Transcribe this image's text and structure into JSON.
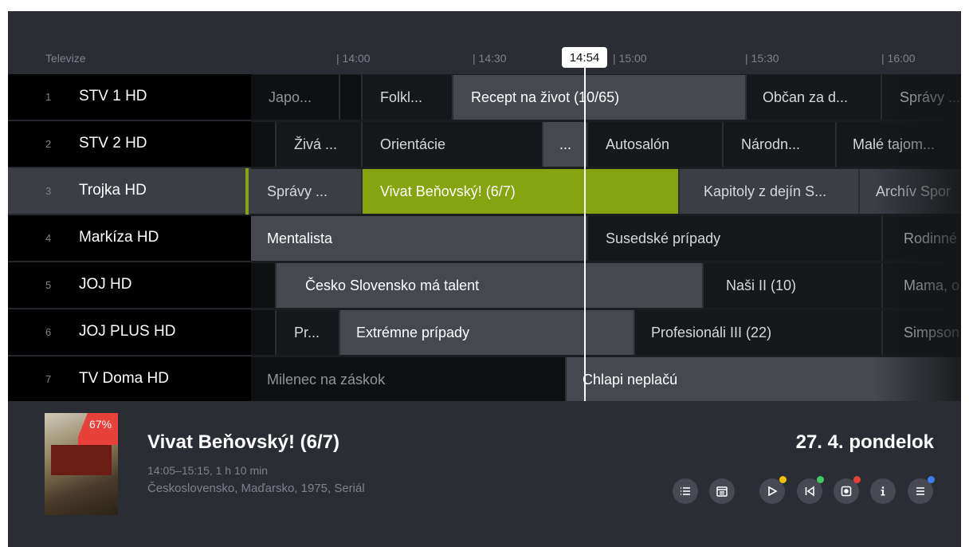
{
  "header": {
    "section_label": "Televize",
    "time_ticks": [
      "| 14:00",
      "| 14:30",
      "| 15:00",
      "| 15:30",
      "| 16:00"
    ],
    "current_time": "14:54"
  },
  "channels": [
    {
      "number": "1",
      "name": "STV 1 HD"
    },
    {
      "number": "2",
      "name": "STV 2 HD"
    },
    {
      "number": "3",
      "name": "Trojka HD"
    },
    {
      "number": "4",
      "name": "Markíza HD"
    },
    {
      "number": "5",
      "name": "JOJ HD"
    },
    {
      "number": "6",
      "name": "JOJ PLUS HD"
    },
    {
      "number": "7",
      "name": "TV Doma HD"
    }
  ],
  "schedule": [
    [
      "Japo...",
      "",
      "Folkl...",
      "Recept na život (10/65)",
      "Občan za d...",
      "Správy ..."
    ],
    [
      "Živá ...",
      "Orientácie",
      "...",
      "Autosalón",
      "Národn...",
      "Malé tajom..."
    ],
    [
      "Správy ...",
      "Vivat Beňovský! (6/7)",
      "Kapitoly z dejín S...",
      "Archív Spor"
    ],
    [
      "Mentalista",
      "Susedské prípady",
      "Rodinné"
    ],
    [
      "Česko Slovensko má talent",
      "Naši II (10)",
      "Mama, o"
    ],
    [
      "Pr...",
      "Extrémne prípady",
      "Profesionáli III (22)",
      "Simpson"
    ],
    [
      "Milenec na záskok",
      "Chlapi neplačú"
    ]
  ],
  "info": {
    "progress": "67%",
    "title": "Vivat Beňovský! (6/7)",
    "time": "14:05–15:15, 1 h 10 min",
    "meta": "Československo, Maďarsko, 1975, Seriál",
    "date": "27. 4. pondelok"
  },
  "controls": [
    {
      "icon": "list-icon"
    },
    {
      "icon": "calendar-icon"
    },
    {
      "icon": "play-icon",
      "dot": "#f2c200"
    },
    {
      "icon": "restart-icon",
      "dot": "#44c767"
    },
    {
      "icon": "record-icon",
      "dot": "#e8403a"
    },
    {
      "icon": "info-icon"
    },
    {
      "icon": "menu-icon",
      "dot": "#3f7de8"
    }
  ],
  "colors": {
    "selected": "#86a40f",
    "progress_badge": "#e8403a"
  }
}
